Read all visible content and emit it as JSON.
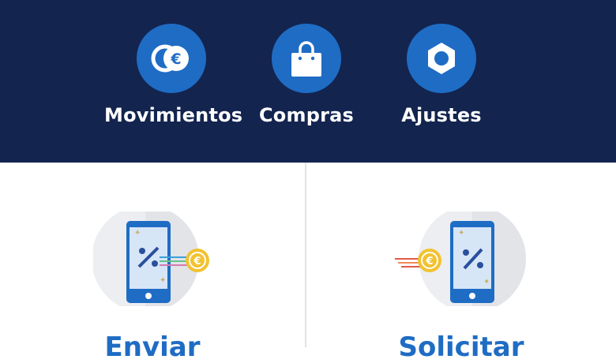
{
  "nav": {
    "items": [
      {
        "label": "Movimientos",
        "icon": "euro-coins-icon"
      },
      {
        "label": "Compras",
        "icon": "shopping-bag-icon"
      },
      {
        "label": "Ajustes",
        "icon": "hex-nut-settings-icon"
      }
    ]
  },
  "actions": {
    "send": {
      "label": "Enviar",
      "icon": "phone-send-euro-icon"
    },
    "request": {
      "label": "Solicitar",
      "icon": "phone-request-euro-icon"
    }
  },
  "colors": {
    "header_bg": "#13244f",
    "accent_blue": "#1f6cc4",
    "coin_gold": "#f2c230"
  }
}
